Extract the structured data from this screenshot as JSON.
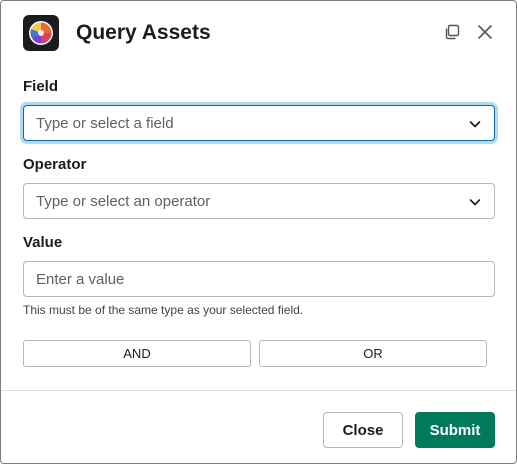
{
  "header": {
    "title": "Query Assets",
    "app_icon": "app-logo-icon",
    "popout_icon": "popout-icon",
    "close_icon": "close-icon"
  },
  "form": {
    "field": {
      "label": "Field",
      "placeholder": "Type or select a field"
    },
    "operator": {
      "label": "Operator",
      "placeholder": "Type or select an operator"
    },
    "value": {
      "label": "Value",
      "placeholder": "Enter a value",
      "hint": "This must be of the same type as your selected field."
    },
    "and_label": "AND",
    "or_label": "OR"
  },
  "footer": {
    "close_label": "Close",
    "submit_label": "Submit"
  },
  "colors": {
    "submit_bg": "#007a5a",
    "focus_ring": "#1264a3"
  }
}
